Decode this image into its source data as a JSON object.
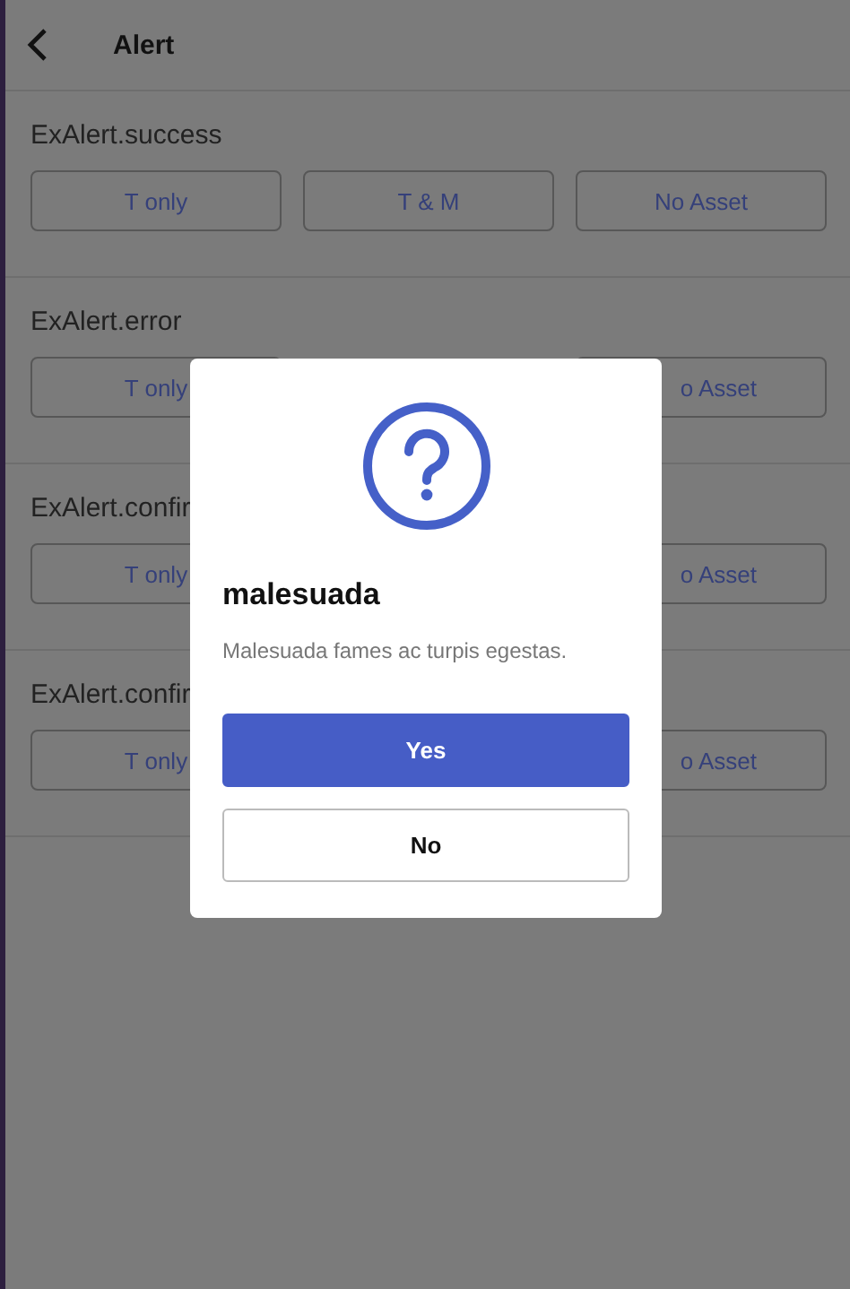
{
  "header": {
    "title": "Alert"
  },
  "sections": [
    {
      "title": "ExAlert.success",
      "buttons": [
        {
          "label": "T only",
          "kind": "left"
        },
        {
          "label": "T & M",
          "kind": "middle"
        },
        {
          "label": "No Asset",
          "kind": "right"
        }
      ]
    },
    {
      "title": "ExAlert.error",
      "buttons": [
        {
          "label": "T only",
          "kind": "left"
        },
        {
          "label": "o Asset",
          "kind": "right"
        }
      ]
    },
    {
      "title": "ExAlert.confir",
      "buttons": [
        {
          "label": "T only",
          "kind": "left"
        },
        {
          "label": "o Asset",
          "kind": "right"
        }
      ]
    },
    {
      "title": "ExAlert.confir",
      "buttons": [
        {
          "label": "T only",
          "kind": "left"
        },
        {
          "label": "o Asset",
          "kind": "right"
        }
      ]
    }
  ],
  "dialog": {
    "title": "malesuada",
    "message": "Malesuada fames ac turpis egestas.",
    "buttons": [
      {
        "label": "Yes",
        "kind": "primary"
      },
      {
        "label": "No",
        "kind": "secondary"
      }
    ]
  }
}
